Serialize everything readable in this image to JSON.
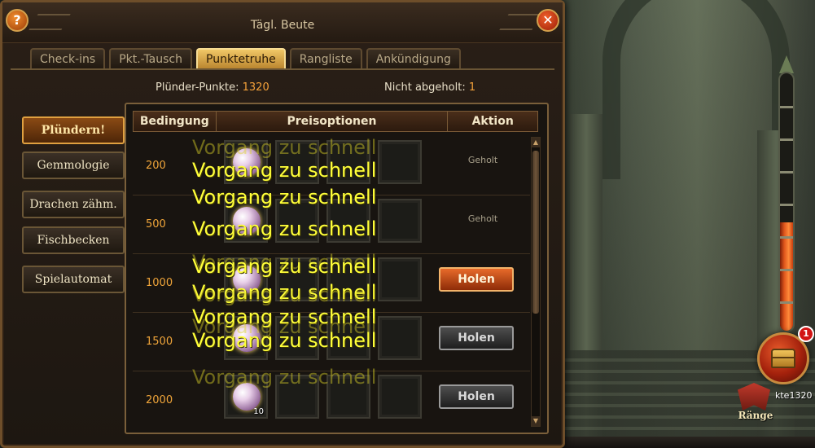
{
  "window": {
    "title": "Tägl. Beute",
    "help_label": "?",
    "close_label": "✕"
  },
  "tabs": [
    {
      "label": "Check-ins",
      "active": false
    },
    {
      "label": "Pkt.-Tausch",
      "active": false
    },
    {
      "label": "Punktetruhe",
      "active": true
    },
    {
      "label": "Rangliste",
      "active": false
    },
    {
      "label": "Ankündigung",
      "active": false
    }
  ],
  "points": {
    "plunder_label": "Plünder-Punkte:",
    "plunder_value": "1320",
    "unclaimed_label": "Nicht abgeholt:",
    "unclaimed_value": "1"
  },
  "side_menu": [
    {
      "label": "Plündern!",
      "active": true
    },
    {
      "label": "Gemmologie",
      "active": false
    },
    {
      "label": "Drachen zähm.",
      "active": false
    },
    {
      "label": "Fischbecken",
      "active": false
    },
    {
      "label": "Spielautomat",
      "active": false
    }
  ],
  "table": {
    "headers": [
      "Bedingung",
      "Preisoptionen",
      "Aktion"
    ],
    "rows": [
      {
        "condition": "200",
        "reward_count": "",
        "action": "Geholt",
        "action_state": "claimed"
      },
      {
        "condition": "500",
        "reward_count": "",
        "action": "Geholt",
        "action_state": "claimed"
      },
      {
        "condition": "1000",
        "reward_count": "",
        "action": "Holen",
        "action_state": "available"
      },
      {
        "condition": "1500",
        "reward_count": "",
        "action": "Holen",
        "action_state": "locked"
      },
      {
        "condition": "2000",
        "reward_count": "10",
        "action": "Holen",
        "action_state": "locked"
      }
    ]
  },
  "toast_text": "Vorgang zu schnell",
  "hud": {
    "chest_badge": "1",
    "rank_label": "Ränge",
    "player_tag": "kte1320",
    "gauge_fill_fraction": 0.42
  },
  "colors": {
    "accent_orange": "#f5a23a",
    "toast_yellow": "#ffff3a",
    "tab_active": "#e0b050"
  }
}
